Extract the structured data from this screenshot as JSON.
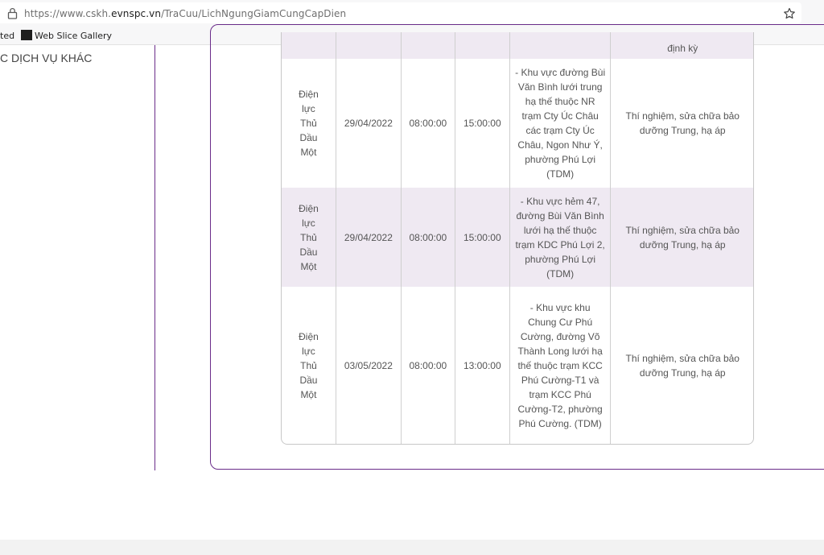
{
  "browser": {
    "url_prefix": "https://www.cskh.",
    "url_domain": "evnspc.vn",
    "url_path": "/TraCuu/LichNgungGiamCungCapDien",
    "bookmarks": [
      {
        "label": "ted"
      },
      {
        "label": "Web Slice Gallery"
      }
    ]
  },
  "sidebar": {
    "title": "C DỊCH VỤ KHÁC"
  },
  "table": {
    "top_partial": "định kỳ",
    "rows": [
      {
        "unit": "Điện lực Thủ Dầu Một",
        "date": "29/04/2022",
        "start": "08:00:00",
        "end": "15:00:00",
        "area": "- Khu vực đường Bùi Văn Bình lưới trung hạ thế thuộc NR trạm Cty Úc Châu các trạm Cty Úc Châu, Ngon Như Ý, phường Phú Lợi (TDM)",
        "reason": "Thí nghiệm, sửa chữa bảo dưỡng Trung, hạ áp"
      },
      {
        "unit": "Điện lực Thủ Dầu Một",
        "date": "29/04/2022",
        "start": "08:00:00",
        "end": "15:00:00",
        "area": "- Khu vực hẻm 47, đường Bùi Văn Bình lưới hạ thế thuộc trạm KDC Phú Lợi 2, phường Phú Lợi (TDM)",
        "reason": "Thí nghiệm, sửa chữa bảo dưỡng Trung, hạ áp"
      },
      {
        "unit": "Điện lực Thủ Dầu Một",
        "date": "03/05/2022",
        "start": "08:00:00",
        "end": "13:00:00",
        "area": "- Khu vực khu Chung Cư Phú Cường, đường Võ Thành Long lưới hạ thế thuộc trạm KCC Phú Cường-T1 và trạm KCC Phú Cường-T2, phường Phú Cường. (TDM)",
        "reason": "Thí nghiệm, sửa chữa bảo dưỡng Trung, hạ áp"
      }
    ]
  }
}
